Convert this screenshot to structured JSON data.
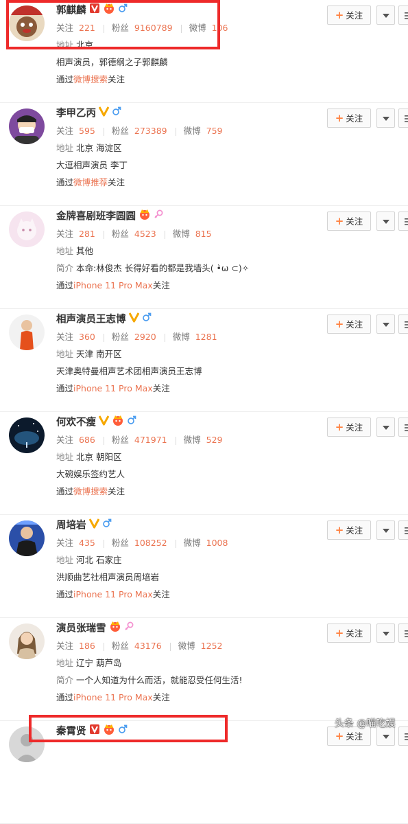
{
  "labels": {
    "follow_button": "关注",
    "stat_following": "关注",
    "stat_followers": "粉丝",
    "stat_posts": "微博",
    "address": "地址",
    "intro": "简介",
    "via_prefix": "通过",
    "via_suffix": "关注"
  },
  "colors": {
    "accent": "#eb7350",
    "highlight_box": "#ee2a2a",
    "verified_badge": "#f6a800",
    "male": "#4d9ef0",
    "female": "#f48fcf"
  },
  "users": [
    {
      "name": "郭麒麟",
      "badges": [
        "verified-v-red",
        "gold-crown-icon",
        "male-icon"
      ],
      "following": "221",
      "followers": "9160789",
      "posts": "106",
      "address": "北京",
      "intro_label": "",
      "description": "相声演员，郭德纲之子郭麒麟",
      "via": "微博搜索",
      "avatar_icon": "lion-avatar"
    },
    {
      "name": "李甲乙丙",
      "badges": [
        "verified-v-gold",
        "male-icon"
      ],
      "following": "595",
      "followers": "273389",
      "posts": "759",
      "address": "北京 海淀区",
      "intro_label": "",
      "description": "大逗相声演员 李丁",
      "via": "微博推荐",
      "avatar_icon": "masked-person-avatar"
    },
    {
      "name": "金牌喜剧班李圆圆",
      "badges": [
        "gold-crown-icon",
        "female-icon"
      ],
      "following": "281",
      "followers": "4523",
      "posts": "815",
      "address": "其他",
      "intro_label": "简介",
      "description": "本命:林俊杰 长得好看的都是我墙头( •̀ω ⊂)✧",
      "via": "iPhone 11 Pro Max",
      "avatar_icon": "pink-cat-avatar"
    },
    {
      "name": "相声演员王志博",
      "badges": [
        "verified-v-gold",
        "male-icon"
      ],
      "following": "360",
      "followers": "2920",
      "posts": "1281",
      "address": "天津 南开区",
      "intro_label": "",
      "description": "天津奥特曼相声艺术团相声演员王志博",
      "via": "iPhone 11 Pro Max",
      "avatar_icon": "orange-robe-avatar"
    },
    {
      "name": "何欢不瘦",
      "badges": [
        "verified-v-gold",
        "gold-crown-icon",
        "male-icon"
      ],
      "following": "686",
      "followers": "471971",
      "posts": "529",
      "address": "北京 朝阳区",
      "intro_label": "",
      "description": "大碗娱乐签约艺人",
      "via": "微博搜索",
      "avatar_icon": "night-sky-avatar"
    },
    {
      "name": "周培岩",
      "badges": [
        "verified-v-gold",
        "male-icon"
      ],
      "following": "435",
      "followers": "108252",
      "posts": "1008",
      "address": "河北 石家庄",
      "intro_label": "",
      "description": "洪顺曲艺社相声演员周培岩",
      "via": "iPhone 11 Pro Max",
      "avatar_icon": "stage-person-avatar"
    },
    {
      "name": "演员张瑞雪",
      "badges": [
        "gold-crown-icon",
        "female-icon"
      ],
      "following": "186",
      "followers": "43176",
      "posts": "1252",
      "address": "辽宁 葫芦岛",
      "intro_label": "简介",
      "description": "一个人知道为什么而活，就能忍受任何生活!",
      "via": "iPhone 11 Pro Max",
      "avatar_icon": "woman-avatar"
    },
    {
      "name": "秦霄贤",
      "badges": [
        "verified-v-red",
        "gold-crown-icon",
        "male-icon"
      ],
      "following": "",
      "followers": "",
      "posts": "",
      "address": "",
      "intro_label": "",
      "description": "",
      "via": "",
      "avatar_icon": "person-avatar"
    }
  ],
  "watermark": "头条 @喵吃娱"
}
